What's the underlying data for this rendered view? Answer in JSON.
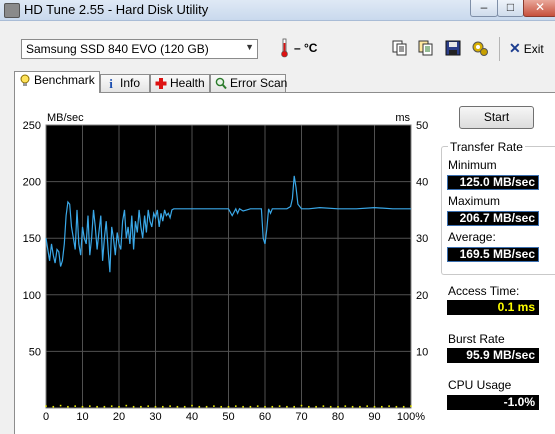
{
  "window": {
    "title": "HD Tune 2.55 - Hard Disk Utility",
    "minimize": "–",
    "maximize": "□",
    "close": "✕"
  },
  "toolbar": {
    "drive": "Samsung SSD 840 EVO (120 GB)",
    "temperature": "– °C",
    "exit_label": "Exit",
    "icons": [
      "copy-icon",
      "copy-all-icon",
      "save-icon",
      "options-icon",
      "exit-icon"
    ]
  },
  "tabs": [
    {
      "label": "Benchmark",
      "icon": "benchmark-icon",
      "active": true
    },
    {
      "label": "Info",
      "icon": "info-icon",
      "active": false
    },
    {
      "label": "Health",
      "icon": "health-icon",
      "active": false
    },
    {
      "label": "Error Scan",
      "icon": "error-scan-icon",
      "active": false
    }
  ],
  "side": {
    "start_label": "Start",
    "transfer_rate_title": "Transfer Rate",
    "minimum_label": "Minimum",
    "minimum_value": "125.0 MB/sec",
    "maximum_label": "Maximum",
    "maximum_value": "206.7 MB/sec",
    "average_label": "Average:",
    "average_value": "169.5 MB/sec",
    "access_time_label": "Access Time:",
    "access_time_value": "0.1 ms",
    "burst_rate_label": "Burst Rate",
    "burst_rate_value": "95.9 MB/sec",
    "cpu_usage_label": "CPU Usage",
    "cpu_usage_value": "-1.0%"
  },
  "colors": {
    "plot_bg": "#000000",
    "grid": "#505050",
    "transfer_line": "#3aa8e8",
    "access_points": "#e8e800"
  },
  "chart_data": {
    "type": "line",
    "ylabel_left": "MB/sec",
    "ylabel_right": "ms",
    "ylim_left": [
      0,
      250
    ],
    "ylim_right": [
      0,
      50
    ],
    "xlim": [
      0,
      100
    ],
    "yticks_left": [
      "0",
      "50",
      "100",
      "150",
      "200",
      "250"
    ],
    "yticks_right": [
      "10",
      "20",
      "30",
      "40",
      "50"
    ],
    "xticks": [
      "0",
      "10",
      "20",
      "30",
      "40",
      "50",
      "60",
      "70",
      "80",
      "90",
      "100%"
    ],
    "grid": true,
    "series": [
      {
        "axis": "left",
        "x": [
          0,
          0.5,
          1,
          1.5,
          2,
          2.5,
          3,
          3.5,
          4,
          4.5,
          5,
          5.5,
          6,
          6.5,
          7,
          7.5,
          8,
          8.5,
          9,
          9.5,
          10,
          10.5,
          11,
          11.5,
          12,
          12.5,
          13,
          13.5,
          14,
          14.5,
          15,
          15.5,
          16,
          16.5,
          17,
          17.5,
          18,
          18.5,
          19,
          19.5,
          20,
          20.5,
          21,
          21.5,
          22,
          22.5,
          23,
          23.5,
          24,
          24.5,
          25,
          25.5,
          26,
          26.5,
          27,
          27.5,
          28,
          28.5,
          29,
          29.5,
          30,
          30.5,
          31,
          31.5,
          32,
          32.5,
          33,
          33.5,
          34,
          34.5,
          35,
          40,
          45,
          50,
          51,
          52,
          52.5,
          53,
          54,
          55,
          56,
          57,
          58,
          59,
          59.5,
          60,
          60.5,
          61,
          61.5,
          62,
          63,
          64,
          65,
          66,
          67,
          67.5,
          68,
          68.5,
          69,
          70,
          71,
          72,
          75,
          80,
          85,
          90,
          95,
          100
        ],
        "values": [
          150,
          140,
          130,
          145,
          135,
          128,
          140,
          138,
          125,
          130,
          145,
          170,
          182,
          180,
          160,
          150,
          140,
          175,
          145,
          135,
          160,
          150,
          145,
          170,
          135,
          150,
          175,
          160,
          140,
          155,
          170,
          130,
          150,
          165,
          140,
          120,
          160,
          150,
          135,
          155,
          145,
          140,
          165,
          175,
          150,
          160,
          145,
          170,
          140,
          165,
          155,
          175,
          160,
          150,
          170,
          155,
          175,
          165,
          160,
          172,
          168,
          175,
          160,
          172,
          165,
          175,
          170,
          172,
          168,
          175,
          176,
          176,
          176,
          176,
          170,
          176,
          172,
          176,
          174,
          175,
          176,
          176,
          176,
          176,
          150,
          145,
          158,
          176,
          172,
          176,
          176,
          176,
          176,
          176,
          178,
          185,
          205,
          195,
          180,
          176,
          176,
          176,
          177,
          176,
          176,
          177,
          176,
          176
        ]
      },
      {
        "axis": "right",
        "x": [
          0,
          2,
          4,
          6,
          8,
          10,
          12,
          14,
          16,
          18,
          20,
          22,
          24,
          26,
          28,
          30,
          32,
          34,
          36,
          38,
          40,
          42,
          44,
          46,
          48,
          50,
          52,
          54,
          56,
          58,
          60,
          62,
          64,
          66,
          68,
          70,
          72,
          74,
          76,
          78,
          80,
          82,
          84,
          86,
          88,
          90,
          92,
          94,
          96,
          98,
          100
        ],
        "values": [
          0.2,
          0.1,
          0.3,
          0.1,
          0.2,
          0.1,
          0.2,
          0.1,
          0.1,
          0.2,
          0.1,
          0.3,
          0.1,
          0.1,
          0.2,
          0.1,
          0.1,
          0.2,
          0.1,
          0.1,
          0.3,
          0.1,
          0.1,
          0.2,
          0.1,
          0.1,
          0.2,
          0.1,
          0.1,
          0.2,
          0.1,
          0.1,
          0.2,
          0.1,
          0.1,
          0.3,
          0.1,
          0.1,
          0.2,
          0.1,
          0.1,
          0.2,
          0.1,
          0.1,
          0.2,
          0.1,
          0.1,
          0.2,
          0.1,
          0.1,
          0.2
        ]
      }
    ]
  }
}
